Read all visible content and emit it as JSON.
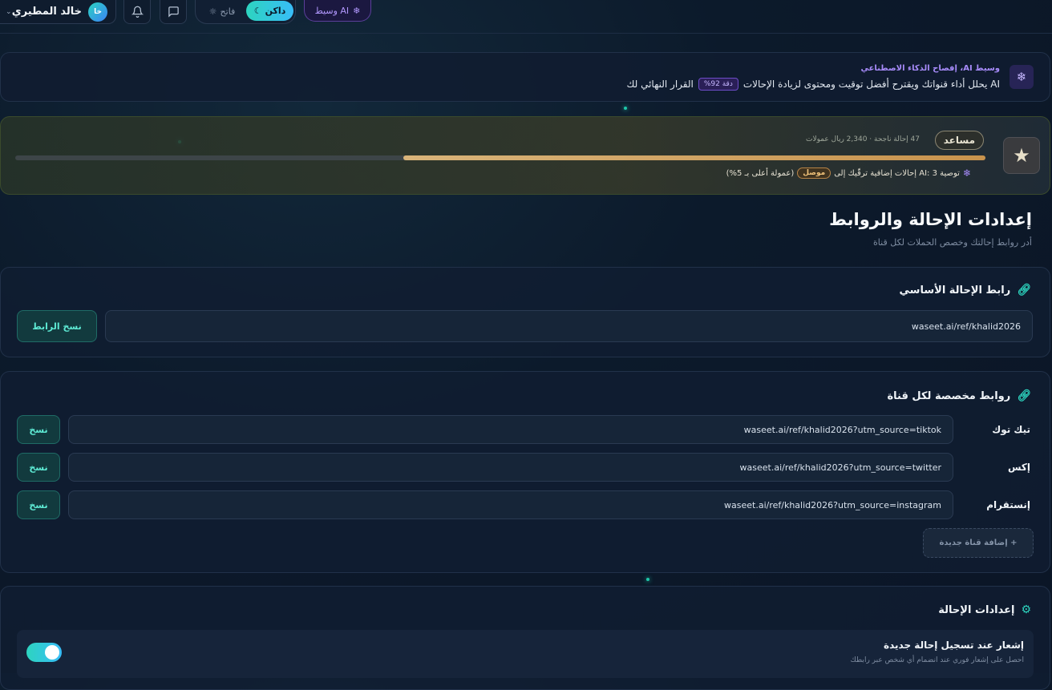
{
  "header": {
    "user_name": "خالد المطيري",
    "user_initials": "خا",
    "theme_dark_label": "داكن",
    "theme_light_label": "فاتح",
    "ai_badge_label": "وسيط AI"
  },
  "ai_banner": {
    "title": "وسيط AI، إفصاح الذكاء الاصطناعي",
    "text_before": "AI يحلل أداء قنواتك ويقترح أفضل توقيت ومحتوى لزيادة الإحالات",
    "accuracy_badge": "دقة 92%",
    "text_after": "القرار النهائي لك"
  },
  "tier": {
    "label": "مساعد",
    "stats": "47 إحالة ناجحة · 2,340 ريال عمولات",
    "progress": 0.6,
    "rec_prefix": "توصية AI: 3 إحالات إضافية ترقّيك إلى",
    "next_tier": "موصل",
    "rec_suffix": "(عمولة أعلى بـ 5%)"
  },
  "page": {
    "title": "إعدادات الإحالة والروابط",
    "subtitle": "أدر روابط إحالتك وخصص الحملات لكل قناة"
  },
  "main_link": {
    "title": "رابط الإحالة الأساسي",
    "url": "waseet.ai/ref/khalid2026",
    "copy_label": "نسخ الرابط"
  },
  "channels": {
    "title": "روابط مخصصة لكل قناة",
    "items": [
      {
        "name": "تيك توك",
        "url": "waseet.ai/ref/khalid2026?utm_source=tiktok",
        "copy_label": "نسخ"
      },
      {
        "name": "إكس",
        "url": "waseet.ai/ref/khalid2026?utm_source=twitter",
        "copy_label": "نسخ"
      },
      {
        "name": "إنستقرام",
        "url": "waseet.ai/ref/khalid2026?utm_source=instagram",
        "copy_label": "نسخ"
      }
    ],
    "add_label": "+ إضافة قناة جديدة"
  },
  "settings": {
    "title": "إعدادات الإحالة",
    "notif_title": "إشعار عند تسجيل إحالة جديدة",
    "notif_desc": "احصل على إشعار فوري عند انضمام أي شخص عبر رابطك",
    "notif_enabled": true
  },
  "colors": {
    "accent": "#2dd4bf",
    "ai_purple": "#a78bfa",
    "tier_gold": "#d9b47a"
  }
}
